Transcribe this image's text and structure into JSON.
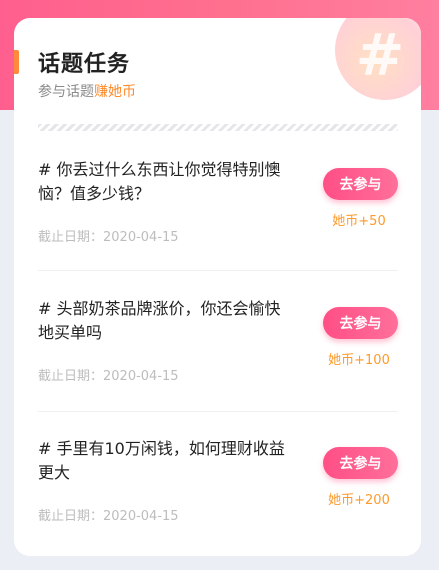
{
  "header": {
    "title": "话题任务",
    "subtitle_prefix": "参与话题",
    "subtitle_highlight": "赚她币",
    "deco_icon": "#"
  },
  "tasks": [
    {
      "title": "# 你丢过什么东西让你觉得特别懊恼？值多少钱？",
      "date": "截止日期：2020-04-15",
      "button": "去参与",
      "reward": "她币+50"
    },
    {
      "title": "# 头部奶茶品牌涨价，你还会愉快地买单吗",
      "date": "截止日期：2020-04-15",
      "button": "去参与",
      "reward": "她币+100"
    },
    {
      "title": "# 手里有10万闲钱，如何理财收益更大",
      "date": "截止日期：2020-04-15",
      "button": "去参与",
      "reward": "她币+200"
    }
  ],
  "colors": {
    "accent_pink": "#ff5f8e",
    "accent_orange": "#ff8a2a",
    "text_dark": "#222222",
    "text_muted": "#bdbdbd"
  }
}
